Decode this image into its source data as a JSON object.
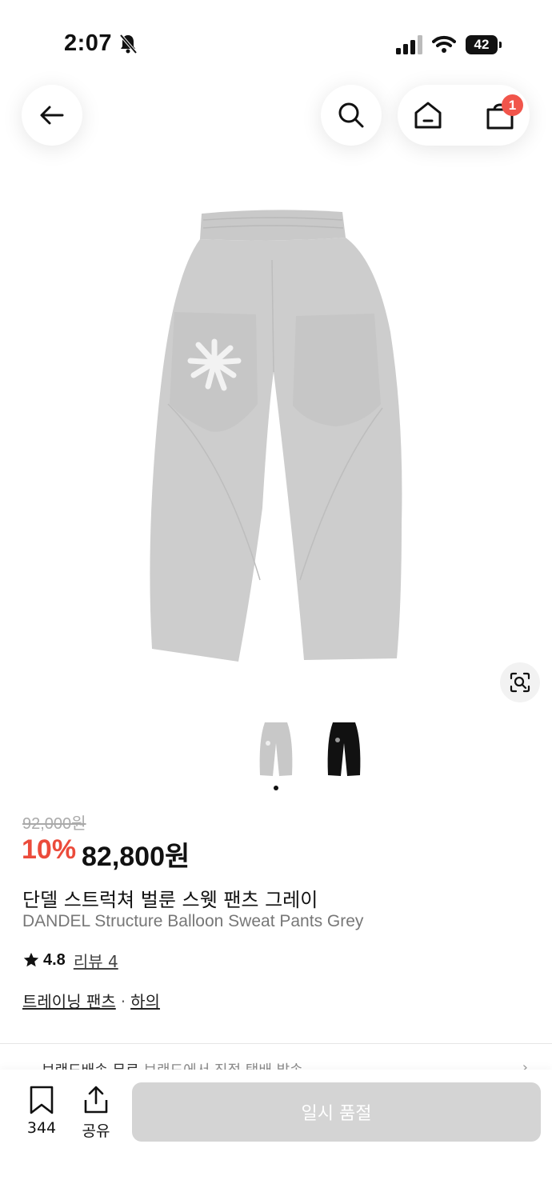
{
  "status_bar": {
    "time": "2:07",
    "battery": "42"
  },
  "header": {
    "cart_count": "1"
  },
  "product": {
    "original_price": "92,000원",
    "discount": "10%",
    "price": "82,800원",
    "name_ko": "단델 스트럭쳐 벌룬 스웻 팬츠 그레이",
    "name_en": "DANDEL Structure Balloon Sweat Pants Grey",
    "rating": "4.8",
    "review_label": "리뷰 4",
    "category_primary": "트레이닝 팬츠",
    "category_separator": "·",
    "category_secondary": "하의"
  },
  "thumbnails": [
    {
      "color": "#c8c8c8"
    },
    {
      "color": "#111111"
    }
  ],
  "delivery_peek": {
    "title": "브랜드배송 무료",
    "subtitle": "브랜드에서 직접 택배 발송",
    "chevron": "›"
  },
  "bottom_bar": {
    "bookmark_count": "344",
    "share_label": "공유",
    "soldout_label": "일시 품절"
  },
  "colors": {
    "discount": "#eb4b3b",
    "badge": "#f1554b",
    "soldout_bg": "#d4d4d4",
    "accent": "#6b5be6"
  },
  "icons": [
    "back-arrow-icon",
    "search-icon",
    "home-icon",
    "cart-icon",
    "visual-search-icon",
    "star-icon",
    "bookmark-icon",
    "share-icon",
    "bell-mute-icon",
    "signal-icon",
    "wifi-icon"
  ]
}
